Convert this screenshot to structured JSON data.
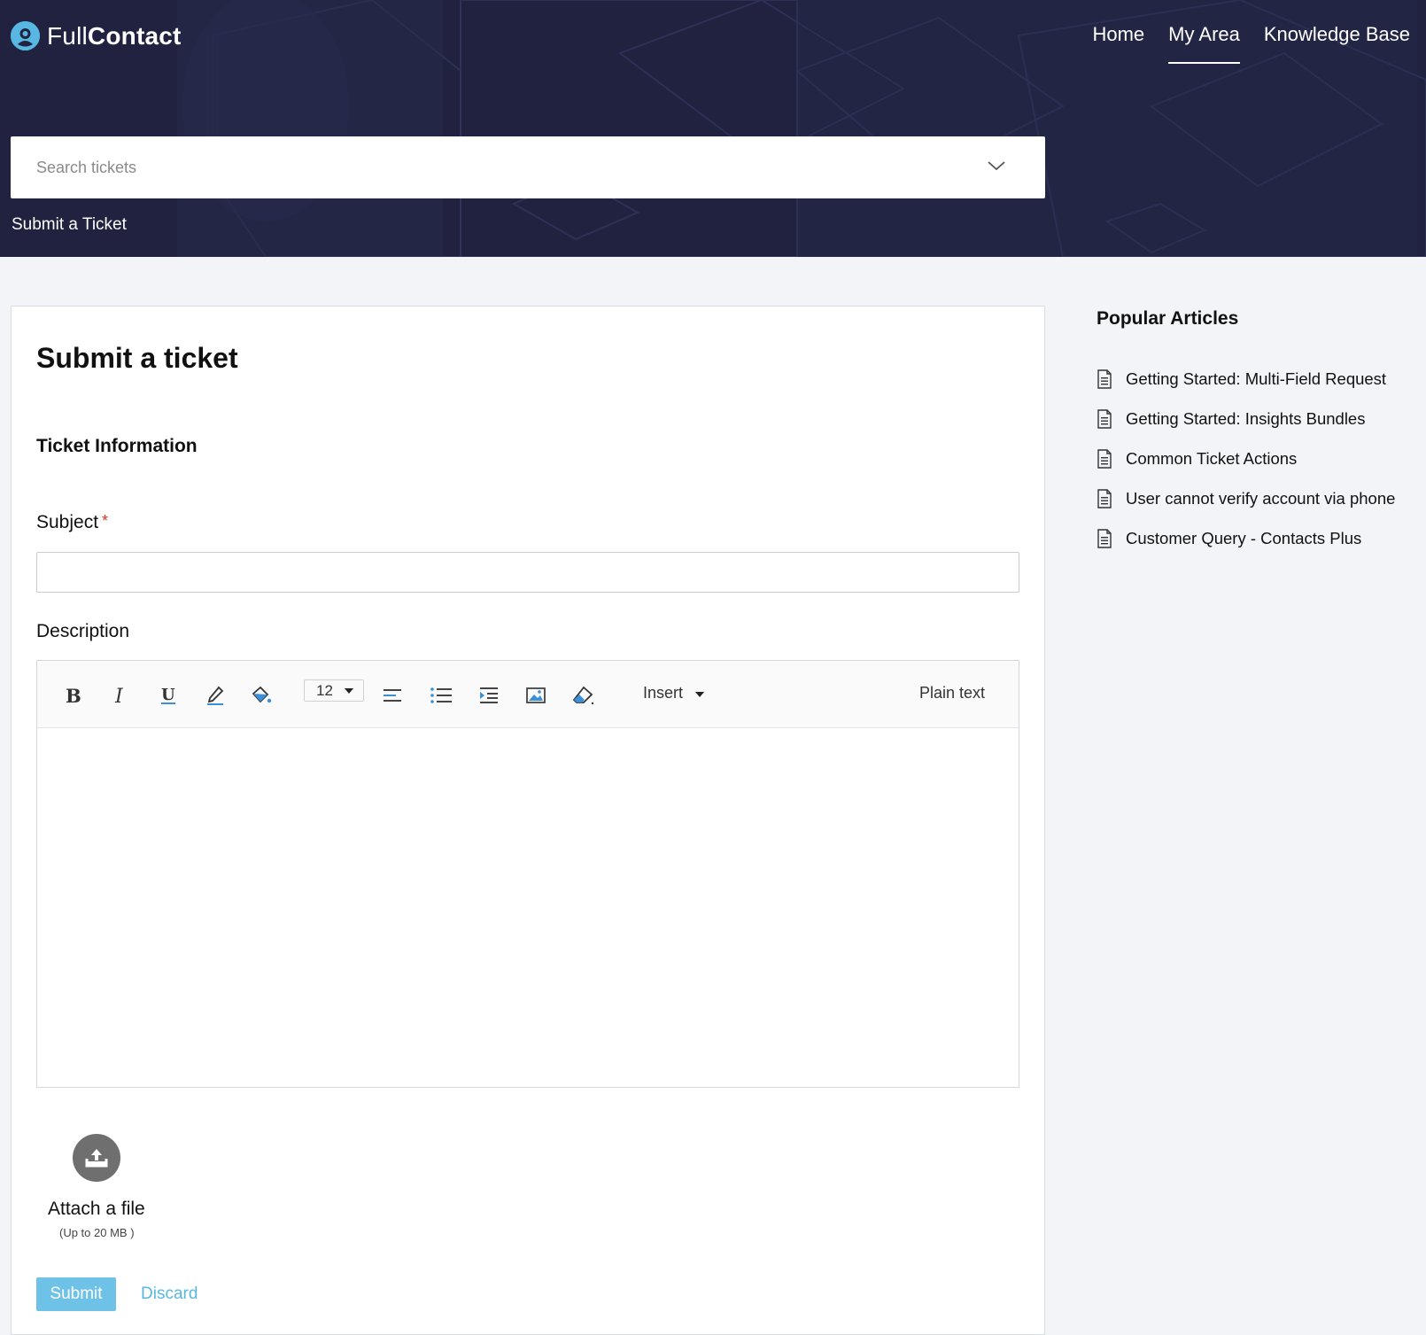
{
  "brand": {
    "name_light": "Full",
    "name_bold": "Contact"
  },
  "nav": {
    "items": [
      "Home",
      "My Area",
      "Knowledge Base"
    ]
  },
  "search": {
    "placeholder": "Search tickets"
  },
  "breadcrumb": "Submit a Ticket",
  "form": {
    "title": "Submit a ticket",
    "section": "Ticket Information",
    "subject_label": "Subject",
    "required_mark": "*",
    "subject_value": "",
    "description_label": "Description",
    "toolbar": {
      "font_size": "12",
      "insert_label": "Insert",
      "plain_text_label": "Plain text",
      "icons": [
        "bold-icon",
        "italic-icon",
        "underline-icon",
        "text-color-icon",
        "background-color-icon",
        "font-size-select",
        "align-left-icon",
        "bullet-list-icon",
        "indent-icon",
        "image-icon",
        "eraser-icon"
      ]
    },
    "attach_label": "Attach a file",
    "attach_limit": "(Up to 20 MB )",
    "submit_label": "Submit",
    "discard_label": "Discard"
  },
  "sidebar": {
    "title": "Popular Articles",
    "articles": [
      "Getting Started: Multi-Field Request",
      "Getting Started: Insights Bundles",
      "Common Ticket Actions",
      "User cannot verify account via phone",
      "Customer Query - Contacts Plus"
    ]
  },
  "colors": {
    "header_bg": "#20223f",
    "accent": "#6ec2e7",
    "link": "#5ab8df",
    "required": "#d0391d"
  }
}
